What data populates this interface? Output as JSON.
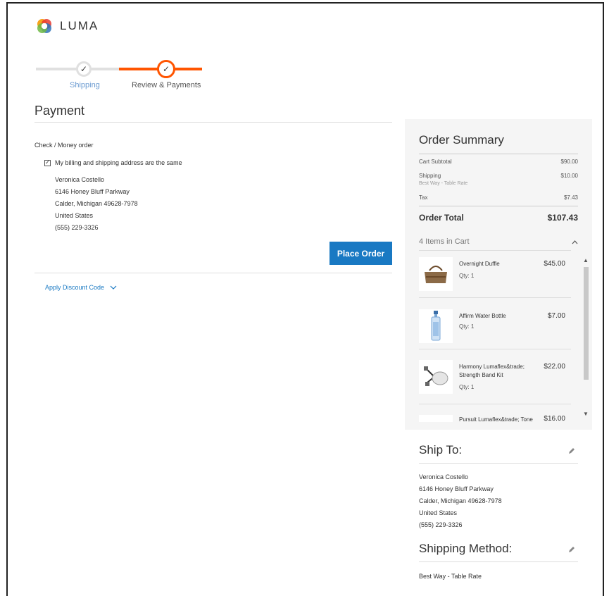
{
  "brand": {
    "name": "LUMA",
    "colors": {
      "accent": "#ff5501",
      "primary": "#1979c3"
    }
  },
  "progress": {
    "steps": [
      {
        "label": "Shipping",
        "state": "complete"
      },
      {
        "label": "Review & Payments",
        "state": "active"
      }
    ]
  },
  "payment": {
    "title": "Payment",
    "method": "Check / Money order",
    "same_address_label": "My billing and shipping address are the same",
    "same_address_checked": true,
    "billing_address": {
      "name": "Veronica Costello",
      "street": "6146 Honey Bluff Parkway",
      "city_line": "Calder, Michigan 49628-7978",
      "country": "United States",
      "phone": "(555) 229-3326"
    },
    "place_order_label": "Place Order",
    "discount_label": "Apply Discount Code"
  },
  "summary": {
    "title": "Order Summary",
    "subtotal_label": "Cart Subtotal",
    "subtotal_value": "$90.00",
    "shipping_label": "Shipping",
    "shipping_sub": "Best Way - Table Rate",
    "shipping_value": "$10.00",
    "tax_label": "Tax",
    "tax_value": "$7.43",
    "total_label": "Order Total",
    "total_value": "$107.43",
    "items_header": "4 Items in Cart",
    "items": [
      {
        "name": "Overnight Duffle",
        "qty": "Qty: 1",
        "price": "$45.00",
        "icon": "duffle-bag-icon"
      },
      {
        "name": "Affirm Water Bottle",
        "qty": "Qty: 1",
        "price": "$7.00",
        "icon": "water-bottle-icon"
      },
      {
        "name": "Harmony Lumaflex&trade; Strength Band Kit",
        "qty": "Qty: 1",
        "price": "$22.00",
        "icon": "band-kit-icon"
      },
      {
        "name": "Pursuit Lumaflex&trade; Tone",
        "qty": "",
        "price": "$16.00",
        "icon": "tone-band-icon"
      }
    ]
  },
  "ship_to": {
    "title": "Ship To:",
    "address": {
      "name": "Veronica Costello",
      "street": "6146 Honey Bluff Parkway",
      "city_line": "Calder, Michigan 49628-7978",
      "country": "United States",
      "phone": "(555) 229-3326"
    }
  },
  "shipping_method": {
    "title": "Shipping Method:",
    "value": "Best Way - Table Rate"
  }
}
